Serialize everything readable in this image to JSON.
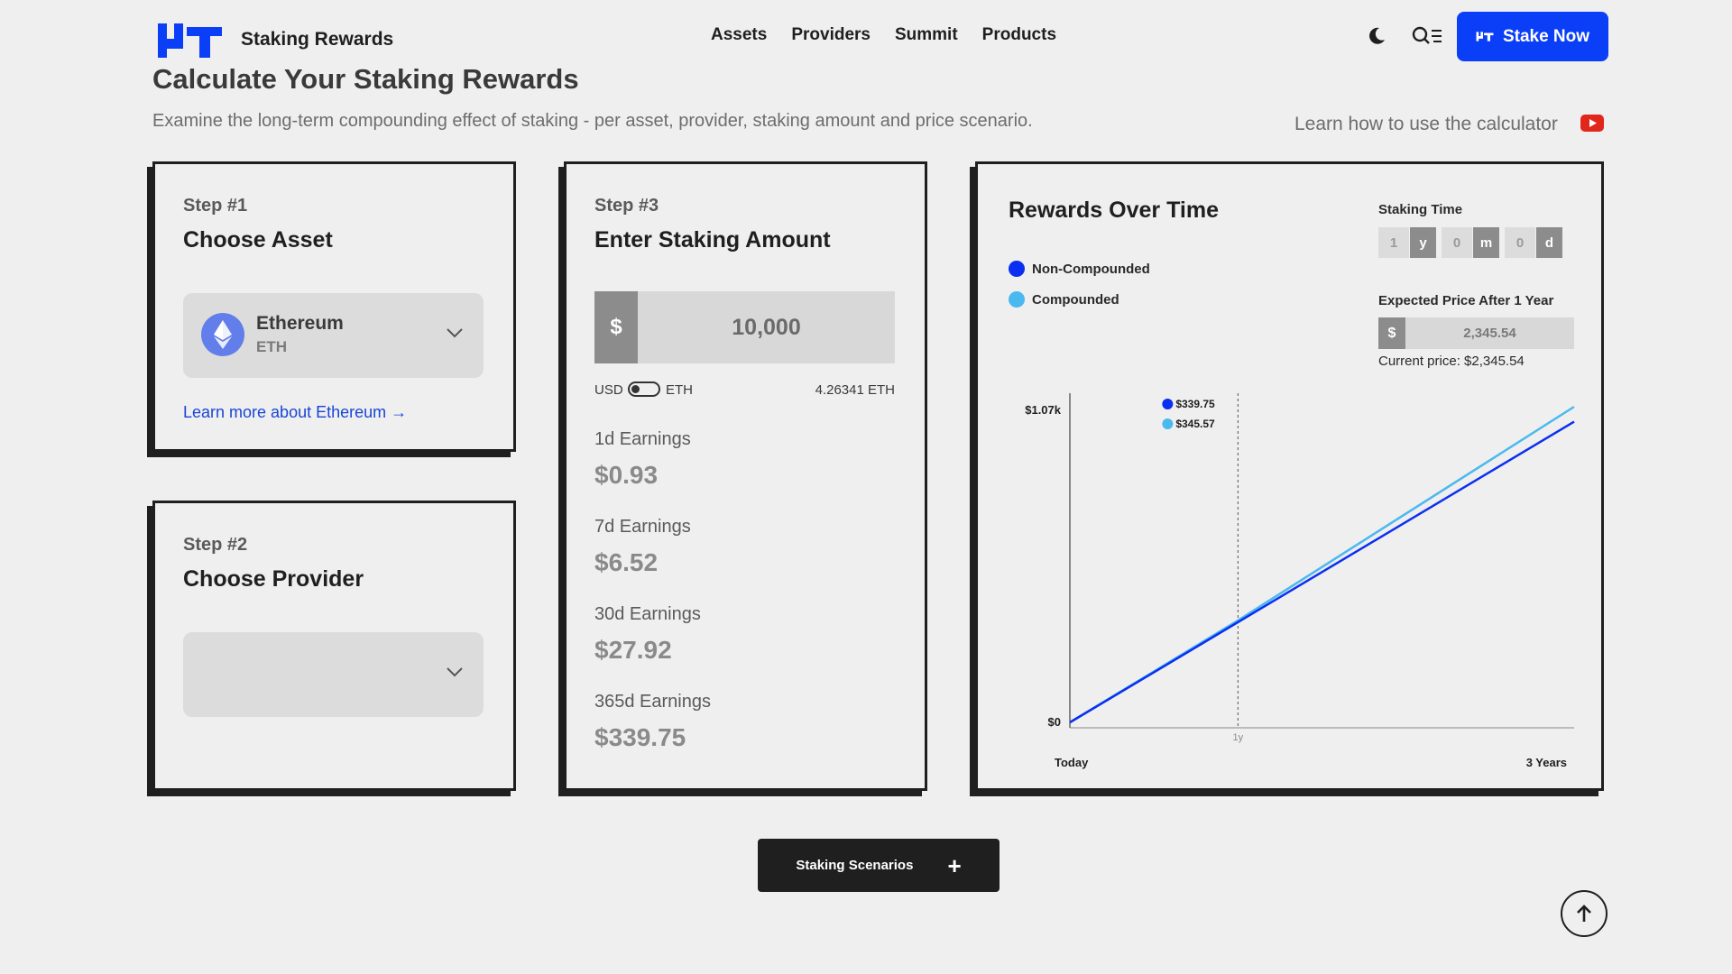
{
  "header": {
    "brand": "Staking Rewards",
    "nav": [
      "Assets",
      "Providers",
      "Summit",
      "Products"
    ],
    "stake_now": "Stake Now"
  },
  "page": {
    "title": "Calculate Your Staking Rewards",
    "subtitle": "Examine the long-term compounding effect of staking - per asset, provider, staking amount and price scenario.",
    "learn_how": "Learn how to use the calculator"
  },
  "step1": {
    "label": "Step #1",
    "title": "Choose Asset",
    "asset_name": "Ethereum",
    "asset_symbol": "ETH",
    "learn_more": "Learn more about Ethereum →"
  },
  "step2": {
    "label": "Step #2",
    "title": "Choose Provider"
  },
  "step3": {
    "label": "Step #3",
    "title": "Enter Staking Amount",
    "currency_symbol": "$",
    "amount": "10,000",
    "toggle_left": "USD",
    "toggle_right": "ETH",
    "conversion": "4.26341 ETH",
    "earnings": [
      {
        "label": "1d Earnings",
        "value": "$0.93"
      },
      {
        "label": "7d Earnings",
        "value": "$6.52"
      },
      {
        "label": "30d Earnings",
        "value": "$27.92"
      },
      {
        "label": "365d Earnings",
        "value": "$339.75"
      }
    ]
  },
  "rewards": {
    "title": "Rewards Over Time",
    "legend": [
      {
        "label": "Non-Compounded",
        "color": "#0b2ff0"
      },
      {
        "label": "Compounded",
        "color": "#4ab9f0"
      }
    ],
    "staking_time_label": "Staking Time",
    "staking_time": [
      {
        "value": "1",
        "unit": "y"
      },
      {
        "value": "0",
        "unit": "m"
      },
      {
        "value": "0",
        "unit": "d"
      }
    ],
    "expected_price_label": "Expected Price After 1 Year",
    "price_symbol": "$",
    "expected_price": "2,345.54",
    "current_price": "Current price: $2,345.54",
    "tooltip": [
      "$339.75",
      "$345.57"
    ]
  },
  "chart_data": {
    "type": "line",
    "x_labels": [
      "Today",
      "1y",
      "3 Years"
    ],
    "x_range_years": [
      0,
      3
    ],
    "marker_year": 1,
    "y_tick_labels": [
      "$0",
      "$1.07k"
    ],
    "ylim": [
      0,
      1070
    ],
    "series": [
      {
        "name": "Non-Compounded",
        "color": "#0b2ff0",
        "x": [
          0,
          1,
          3
        ],
        "y": [
          0,
          339.75,
          1019.25
        ]
      },
      {
        "name": "Compounded",
        "color": "#4ab9f0",
        "x": [
          0,
          1,
          3
        ],
        "y": [
          0,
          345.57,
          1070
        ]
      }
    ]
  },
  "bottom": {
    "scenarios": "Staking Scenarios",
    "plus": "+"
  }
}
